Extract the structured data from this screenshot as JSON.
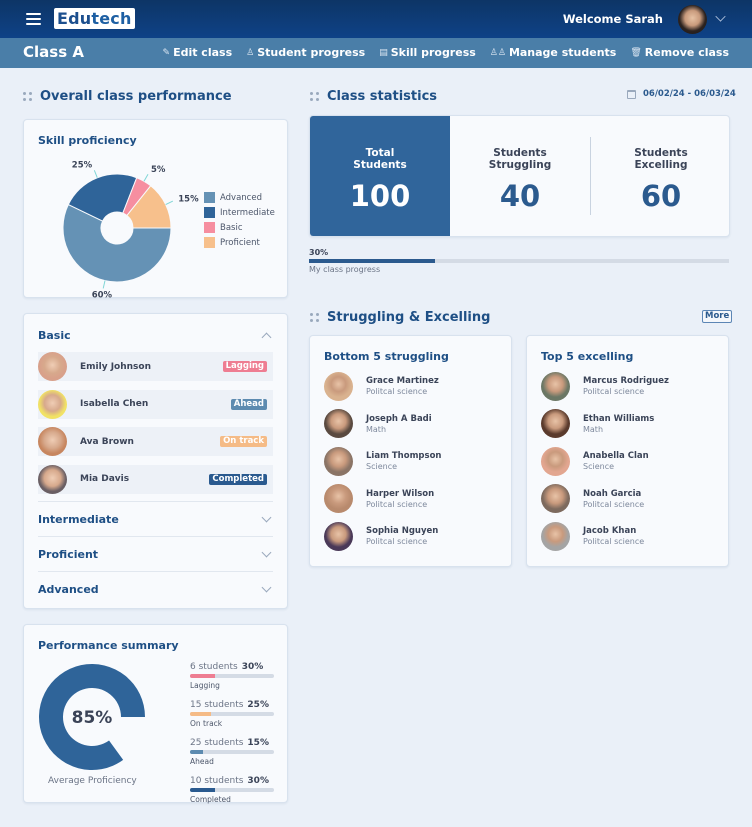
{
  "header": {
    "logo_prefix": "Edu",
    "logo_suffix": "tech",
    "welcome": "Welcome Sarah",
    "menu_icon": "hamburger-menu-icon",
    "profile_chevron_icon": "chevron-down-icon"
  },
  "subbar": {
    "class_name": "Class A",
    "actions": [
      {
        "label": "Edit class",
        "icon": "pencil-icon",
        "glyph": "✎"
      },
      {
        "label": "Student progress",
        "icon": "user-icon",
        "glyph": "♙"
      },
      {
        "label": "Skill progress",
        "icon": "document-icon",
        "glyph": "▤"
      },
      {
        "label": "Manage students",
        "icon": "users-icon",
        "glyph": "♙♙"
      },
      {
        "label": "Remove class",
        "icon": "trash-icon",
        "glyph": "🗑"
      }
    ]
  },
  "overall": {
    "title": "Overall class performance",
    "skill_proficiency": {
      "title": "Skill proficiency",
      "legend": [
        {
          "label": "Advanced",
          "color": "#6592b5"
        },
        {
          "label": "Intermediate",
          "color": "#2f6499"
        },
        {
          "label": "Basic",
          "color": "#f68ea0"
        },
        {
          "label": "Proficient",
          "color": "#f7c08c"
        }
      ]
    },
    "basic": {
      "title": "Basic",
      "students": [
        {
          "name": "Emily Johnson",
          "status": "Lagging",
          "color": "#ee7d92"
        },
        {
          "name": "Isabella Chen",
          "status": "Ahead",
          "color": "#5d8bb0"
        },
        {
          "name": "Ava Brown",
          "status": "On track",
          "color": "#f5bb86"
        },
        {
          "name": "Mia Davis",
          "status": "Completed",
          "color": "#2a5a8f"
        }
      ]
    },
    "collapsed_sections": [
      "Intermediate",
      "Proficient",
      "Advanced"
    ],
    "performance_summary": {
      "title": "Performance summary",
      "average_value": "85%",
      "average_fraction": 0.85,
      "average_label": "Average Proficiency",
      "items": [
        {
          "students": "6 students",
          "pct_label": "30%",
          "pct": 30,
          "label": "Lagging",
          "color": "#ee7d92"
        },
        {
          "students": "15 students",
          "pct_label": "25%",
          "pct": 25,
          "label": "On track",
          "color": "#f5bb86"
        },
        {
          "students": "25 students",
          "pct_label": "15%",
          "pct": 15,
          "label": "Ahead",
          "color": "#5d8bb0"
        },
        {
          "students": "10 students",
          "pct_label": "30%",
          "pct": 30,
          "label": "Completed",
          "color": "#2a5a8f"
        }
      ]
    }
  },
  "class_stats": {
    "title": "Class statistics",
    "date_range": "06/02/24 - 06/03/24",
    "total_label_1": "Total",
    "total_label_2": "Students",
    "total_value": "100",
    "struggling_label_1": "Students",
    "struggling_label_2": "Struggling",
    "struggling_value": "40",
    "excelling_label_1": "Students",
    "excelling_label_2": "Excelling",
    "excelling_value": "60",
    "progress_label": "30%",
    "progress_value": 30,
    "progress_caption": "My class progress"
  },
  "struggling_excelling": {
    "title": "Struggling & Excelling",
    "more_label": "More",
    "bottom": {
      "title": "Bottom 5 struggling",
      "people": [
        {
          "name": "Grace Martinez",
          "subject": "Politcal science"
        },
        {
          "name": "Joseph A Badi",
          "subject": "Math"
        },
        {
          "name": "Liam Thompson",
          "subject": "Science"
        },
        {
          "name": "Harper Wilson",
          "subject": "Politcal science"
        },
        {
          "name": "Sophia Nguyen",
          "subject": "Politcal science"
        }
      ]
    },
    "top": {
      "title": "Top 5 excelling",
      "people": [
        {
          "name": "Marcus Rodriguez",
          "subject": "Politcal science"
        },
        {
          "name": "Ethan Williams",
          "subject": "Math"
        },
        {
          "name": "Anabella Clan",
          "subject": "Science"
        },
        {
          "name": "Noah Garcia",
          "subject": "Politcal science"
        },
        {
          "name": "Jacob Khan",
          "subject": "Politcal science"
        }
      ]
    }
  },
  "chart_data": [
    {
      "type": "pie",
      "title": "Skill proficiency",
      "categories": [
        "Advanced",
        "Intermediate",
        "Basic",
        "Proficient"
      ],
      "values": [
        60,
        25,
        5,
        15
      ],
      "labels": [
        "60%",
        "25%",
        "5%",
        "15%"
      ],
      "colors": [
        "#6592b5",
        "#2f6499",
        "#f68ea0",
        "#f7c08c"
      ],
      "donut": true,
      "legend": "right"
    },
    {
      "type": "pie",
      "title": "Average Proficiency",
      "categories": [
        "Average Proficiency"
      ],
      "values": [
        85
      ],
      "labels": [
        "85%"
      ],
      "colors": [
        "#2f6499"
      ],
      "donut": true
    }
  ]
}
